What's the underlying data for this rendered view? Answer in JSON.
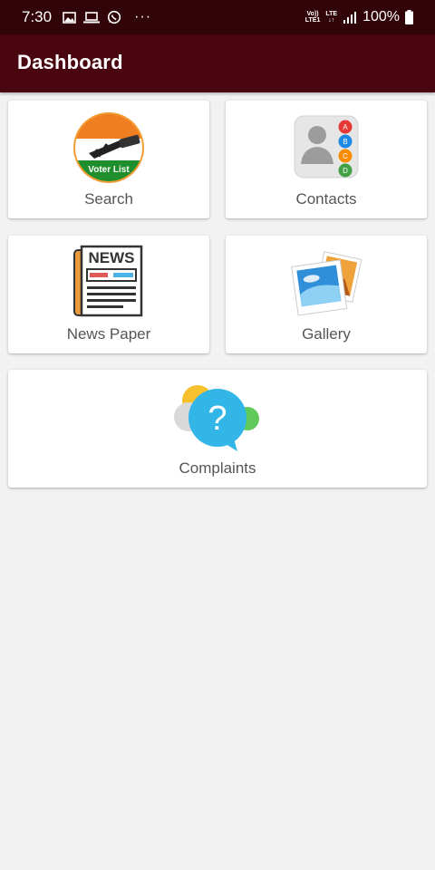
{
  "status_bar": {
    "time": "7:30",
    "more": "···",
    "volte_top": "Vo))",
    "volte_bottom": "LTE1",
    "lte_top": "LTE",
    "lte_bottom": "↓↑",
    "battery": "100%",
    "icons": [
      "image-icon",
      "laptop-icon",
      "whatsapp-icon",
      "signal-icon",
      "battery-icon"
    ]
  },
  "app_bar": {
    "title": "Dashboard"
  },
  "tiles": [
    {
      "label": "Search",
      "icon": "voter-list-icon",
      "icon_text": "Voter List"
    },
    {
      "label": "Contacts",
      "icon": "contacts-icon",
      "badges": [
        "A",
        "B",
        "C",
        "D"
      ]
    },
    {
      "label": "News Paper",
      "icon": "newspaper-icon",
      "icon_text": "NEWS"
    },
    {
      "label": "Gallery",
      "icon": "gallery-icon"
    },
    {
      "label": "Complaints",
      "icon": "question-bubble-icon",
      "icon_text": "?"
    }
  ],
  "colors": {
    "status_bar": "#300408",
    "app_bar": "#4a0610",
    "background": "#f2f2f2",
    "badge_red": "#e53935",
    "badge_blue": "#1e88e5",
    "badge_orange": "#fb8c00",
    "badge_green": "#43a047"
  }
}
